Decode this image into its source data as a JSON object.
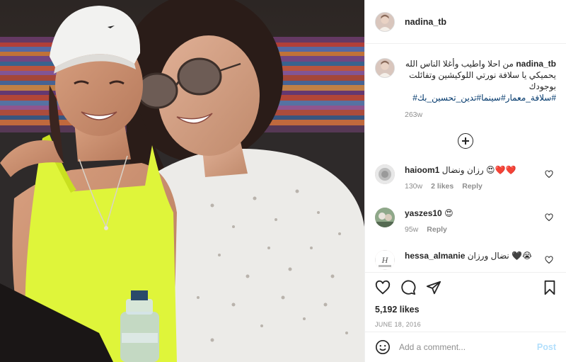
{
  "post": {
    "username": "nadina_tb",
    "caption": {
      "username": "nadina_tb",
      "text": "من احلا واطيب وأغلا الناس الله يحميكي يا سلافة نورتي اللوكيشين وتفائلت بوجودك",
      "hashtags": "#سلافة_معمار#سينما#تدين_تحسين_بك#",
      "age": "263w"
    },
    "comments": [
      {
        "username": "haioom1",
        "text": "رزان ونضال",
        "emoji": "😍❤️❤️",
        "emoji_before": "😍😭",
        "age": "130w",
        "likes": "2 likes",
        "reply": "Reply"
      },
      {
        "username": "yaszes10",
        "text": "😍",
        "age": "95w",
        "reply": "Reply"
      },
      {
        "username": "hessa_almanie",
        "text": "نضال ورزان",
        "emoji": "🖤😭"
      }
    ],
    "likes": "5,192 likes",
    "date": "JUNE 18, 2016",
    "add_comment_placeholder": "Add a comment...",
    "post_label": "Post"
  },
  "colors": {
    "link": "#00376b",
    "meta": "#8e8e8e",
    "post_button": "#b2dffc",
    "heart": "#ed4956"
  },
  "icons": {
    "like": "heart-icon",
    "comment": "comment-bubble-icon",
    "share": "paper-plane-icon",
    "save": "bookmark-icon",
    "load_more": "plus-circle-icon",
    "emoji": "smiley-icon"
  }
}
